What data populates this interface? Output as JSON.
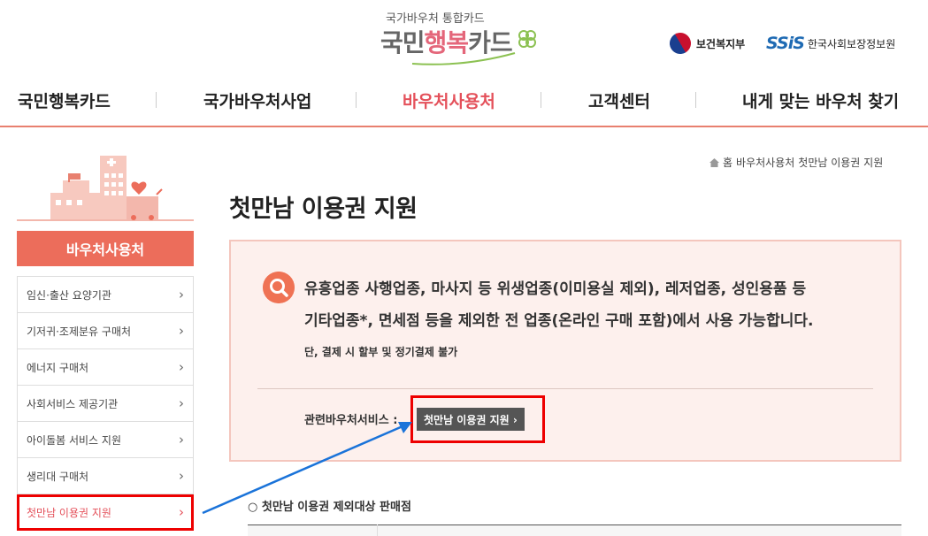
{
  "header": {
    "logo_small": "국가바우처 통합카드",
    "logo_main": {
      "part1": "국민",
      "part2": "행복",
      "part3": "카드"
    },
    "ministry": "보건복지부",
    "ssis_mark": "SSiS",
    "ssis_name": "한국사회보장정보원"
  },
  "nav": {
    "items": [
      {
        "label": "국민행복카드"
      },
      {
        "label": "국가바우처사업"
      },
      {
        "label": "바우처사용처"
      },
      {
        "label": "고객센터"
      },
      {
        "label": "내게 맞는 바우처 찾기"
      }
    ],
    "active_index": 2
  },
  "sidebar": {
    "title": "바우처사용처",
    "items": [
      {
        "label": "임신·출산 요양기관"
      },
      {
        "label": "기저귀·조제분유 구매처"
      },
      {
        "label": "에너지 구매처"
      },
      {
        "label": "사회서비스 제공기관"
      },
      {
        "label": "아이돌봄 서비스 지원"
      },
      {
        "label": "생리대 구매처"
      },
      {
        "label": "첫만남 이용권 지원"
      }
    ],
    "selected_index": 6
  },
  "breadcrumb": {
    "home": "홈",
    "section": "바우처사용처",
    "current": "첫만남 이용권 지원"
  },
  "main": {
    "title": "첫만남 이용권 지원",
    "info": {
      "line1": "유흥업종 사행업종, 마사지 등 위생업종(이미용실 제외), 레저업종, 성인용품 등",
      "line2": "기타업종*, 면세점 등을 제외한 전 업종(온라인 구매 포함)에서 사용 가능합니다.",
      "line3": "단, 결제 시 할부 및 정기결제 불가",
      "related_label": "관련바우처서비스 :",
      "related_button": "첫만남 이용권 지원 ›"
    },
    "sub_heading": "○ 첫만남 이용권 제외대상 판매점"
  },
  "colors": {
    "accent": "#ec6d5b",
    "active_nav": "#e4505a",
    "highlight": "#ee0000",
    "arrow": "#1a73d9"
  }
}
